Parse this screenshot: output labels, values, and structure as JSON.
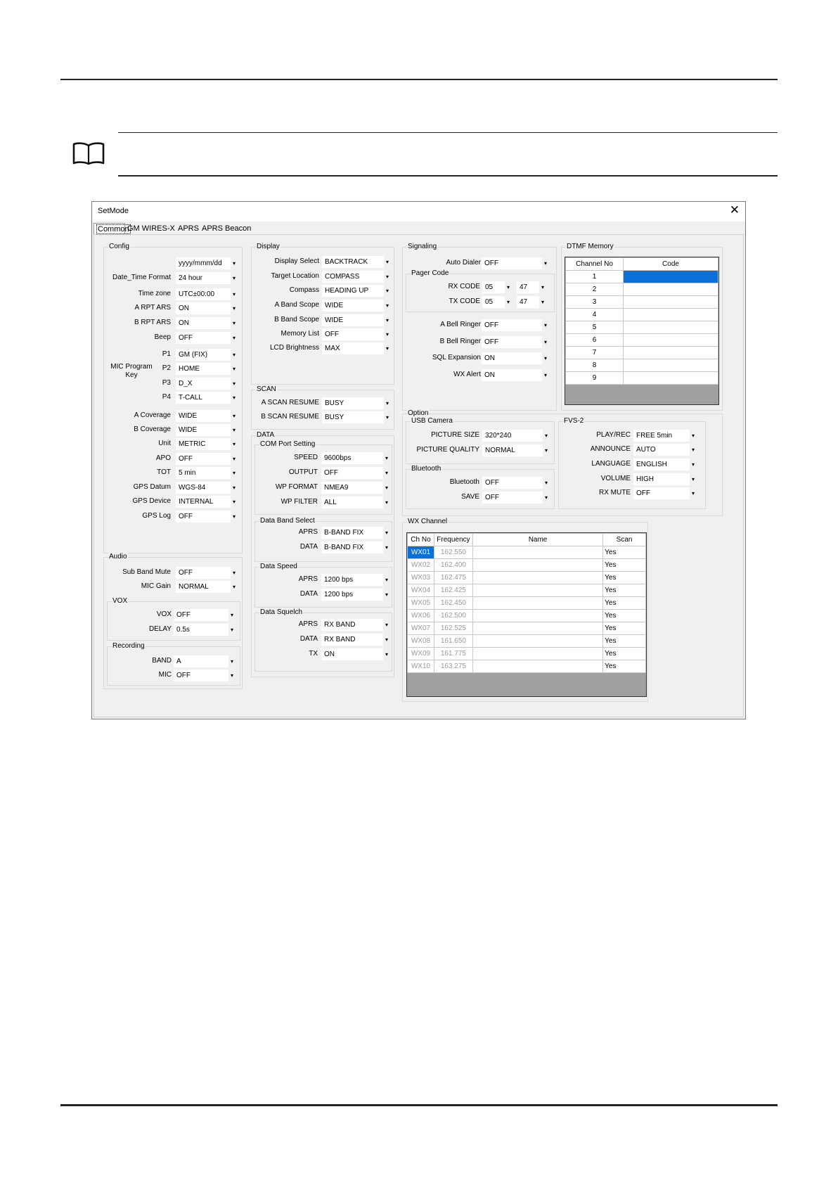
{
  "window": {
    "title": "SetMode",
    "close_glyph": "✕"
  },
  "tabs": [
    "Common",
    "GM WIRES-X",
    "APRS",
    "APRS Beacon"
  ],
  "groups": {
    "config": "Config",
    "audio": "Audio",
    "vox": "VOX",
    "recording": "Recording",
    "display": "Display",
    "scan": "SCAN",
    "data": "DATA",
    "com_port": "COM Port Setting",
    "data_band": "Data Band Select",
    "data_speed": "Data Speed",
    "data_squelch": "Data Squelch",
    "signaling": "Signaling",
    "pager_code": "Pager Code",
    "dtmf": "DTMF Memory",
    "option": "Option",
    "usb_camera": "USB Camera",
    "bluetooth": "Bluetooth",
    "fvs2": "FVS-2",
    "wx_channel": "WX Channel"
  },
  "config": {
    "datetime_label": "Date_Time Format",
    "date_format": "yyyy/mmm/dd",
    "time_format": "24 hour",
    "rows": [
      {
        "label": "Time zone",
        "value": "UTC±00:00"
      },
      {
        "label": "A RPT ARS",
        "value": "ON"
      },
      {
        "label": "B RPT ARS",
        "value": "ON"
      },
      {
        "label": "Beep",
        "value": "OFF"
      }
    ],
    "mic_label": "MIC Program Key",
    "mic_keys": [
      {
        "label": "P1",
        "value": "GM (FIX)"
      },
      {
        "label": "P2",
        "value": "HOME"
      },
      {
        "label": "P3",
        "value": "D_X"
      },
      {
        "label": "P4",
        "value": "T-CALL"
      }
    ],
    "rows2": [
      {
        "label": "A Coverage",
        "value": "WIDE"
      },
      {
        "label": "B Coverage",
        "value": "WIDE"
      },
      {
        "label": "Unit",
        "value": "METRIC"
      },
      {
        "label": "APO",
        "value": "OFF"
      },
      {
        "label": "TOT",
        "value": "5 min"
      },
      {
        "label": "GPS Datum",
        "value": "WGS-84"
      },
      {
        "label": "GPS Device",
        "value": "INTERNAL"
      },
      {
        "label": "GPS Log",
        "value": "OFF"
      }
    ]
  },
  "audio": {
    "rows": [
      {
        "label": "Sub Band Mute",
        "value": "OFF"
      },
      {
        "label": "MIC Gain",
        "value": "NORMAL"
      }
    ],
    "vox": [
      {
        "label": "VOX",
        "value": "OFF"
      },
      {
        "label": "DELAY",
        "value": "0.5s"
      }
    ],
    "recording": [
      {
        "label": "BAND",
        "value": "A"
      },
      {
        "label": "MIC",
        "value": "OFF"
      }
    ]
  },
  "display": {
    "rows": [
      {
        "label": "Display Select",
        "value": "BACKTRACK"
      },
      {
        "label": "Target Location",
        "value": "COMPASS"
      },
      {
        "label": "Compass",
        "value": "HEADING UP"
      },
      {
        "label": "A Band Scope",
        "value": "WIDE"
      },
      {
        "label": "B Band Scope",
        "value": "WIDE"
      },
      {
        "label": "Memory List",
        "value": "OFF"
      },
      {
        "label": "LCD Brightness",
        "value": "MAX"
      }
    ]
  },
  "scan": {
    "rows": [
      {
        "label": "A SCAN RESUME",
        "value": "BUSY"
      },
      {
        "label": "B SCAN RESUME",
        "value": "BUSY"
      }
    ]
  },
  "data": {
    "com_port": [
      {
        "label": "SPEED",
        "value": "9600bps"
      },
      {
        "label": "OUTPUT",
        "value": "OFF"
      },
      {
        "label": "WP FORMAT",
        "value": "NMEA9"
      },
      {
        "label": "WP FILTER",
        "value": "ALL"
      }
    ],
    "band_select": [
      {
        "label": "APRS",
        "value": "B-BAND FIX"
      },
      {
        "label": "DATA",
        "value": "B-BAND FIX"
      }
    ],
    "speed": [
      {
        "label": "APRS",
        "value": "1200 bps"
      },
      {
        "label": "DATA",
        "value": "1200 bps"
      }
    ],
    "squelch": [
      {
        "label": "APRS",
        "value": "RX BAND"
      },
      {
        "label": "DATA",
        "value": "RX BAND"
      },
      {
        "label": "TX",
        "value": "ON"
      }
    ]
  },
  "signaling": {
    "auto_dialer": {
      "label": "Auto Dialer",
      "value": "OFF"
    },
    "pager": [
      {
        "label": "RX CODE",
        "a": "05",
        "b": "47"
      },
      {
        "label": "TX CODE",
        "a": "05",
        "b": "47"
      }
    ],
    "rows": [
      {
        "label": "A Bell Ringer",
        "value": "OFF"
      },
      {
        "label": "B Bell Ringer",
        "value": "OFF"
      },
      {
        "label": "SQL Expansion",
        "value": "ON"
      },
      {
        "label": "WX Alert",
        "value": "ON"
      }
    ]
  },
  "dtmf": {
    "headers": [
      "Channel No",
      "Code"
    ],
    "channels": [
      "1",
      "2",
      "3",
      "4",
      "5",
      "6",
      "7",
      "8",
      "9"
    ]
  },
  "option": {
    "usb_camera": [
      {
        "label": "PICTURE SIZE",
        "value": "320*240"
      },
      {
        "label": "PICTURE QUALITY",
        "value": "NORMAL"
      }
    ],
    "bluetooth": [
      {
        "label": "Bluetooth",
        "value": "OFF"
      },
      {
        "label": "SAVE",
        "value": "OFF"
      }
    ],
    "fvs2": [
      {
        "label": "PLAY/REC",
        "value": "FREE 5min"
      },
      {
        "label": "ANNOUNCE",
        "value": "AUTO"
      },
      {
        "label": "LANGUAGE",
        "value": "ENGLISH"
      },
      {
        "label": "VOLUME",
        "value": "HIGH"
      },
      {
        "label": "RX MUTE",
        "value": "OFF"
      }
    ]
  },
  "wx": {
    "headers": [
      "Ch No",
      "Frequency",
      "Name",
      "Scan"
    ],
    "rows": [
      {
        "ch": "WX01",
        "freq": "162.550",
        "name": "",
        "scan": "Yes"
      },
      {
        "ch": "WX02",
        "freq": "162.400",
        "name": "",
        "scan": "Yes"
      },
      {
        "ch": "WX03",
        "freq": "162.475",
        "name": "",
        "scan": "Yes"
      },
      {
        "ch": "WX04",
        "freq": "162.425",
        "name": "",
        "scan": "Yes"
      },
      {
        "ch": "WX05",
        "freq": "162.450",
        "name": "",
        "scan": "Yes"
      },
      {
        "ch": "WX06",
        "freq": "162.500",
        "name": "",
        "scan": "Yes"
      },
      {
        "ch": "WX07",
        "freq": "162.525",
        "name": "",
        "scan": "Yes"
      },
      {
        "ch": "WX08",
        "freq": "161.650",
        "name": "",
        "scan": "Yes"
      },
      {
        "ch": "WX09",
        "freq": "161.775",
        "name": "",
        "scan": "Yes"
      },
      {
        "ch": "WX10",
        "freq": "163.275",
        "name": "",
        "scan": "Yes"
      }
    ]
  },
  "colors": {
    "selection": "#0a6fd6",
    "dim_text": "#9a9a9a"
  },
  "icons": {
    "note": "book-icon",
    "dropdown": "dropdown-arrow-icon",
    "row_pointer": "row-pointer-icon"
  }
}
